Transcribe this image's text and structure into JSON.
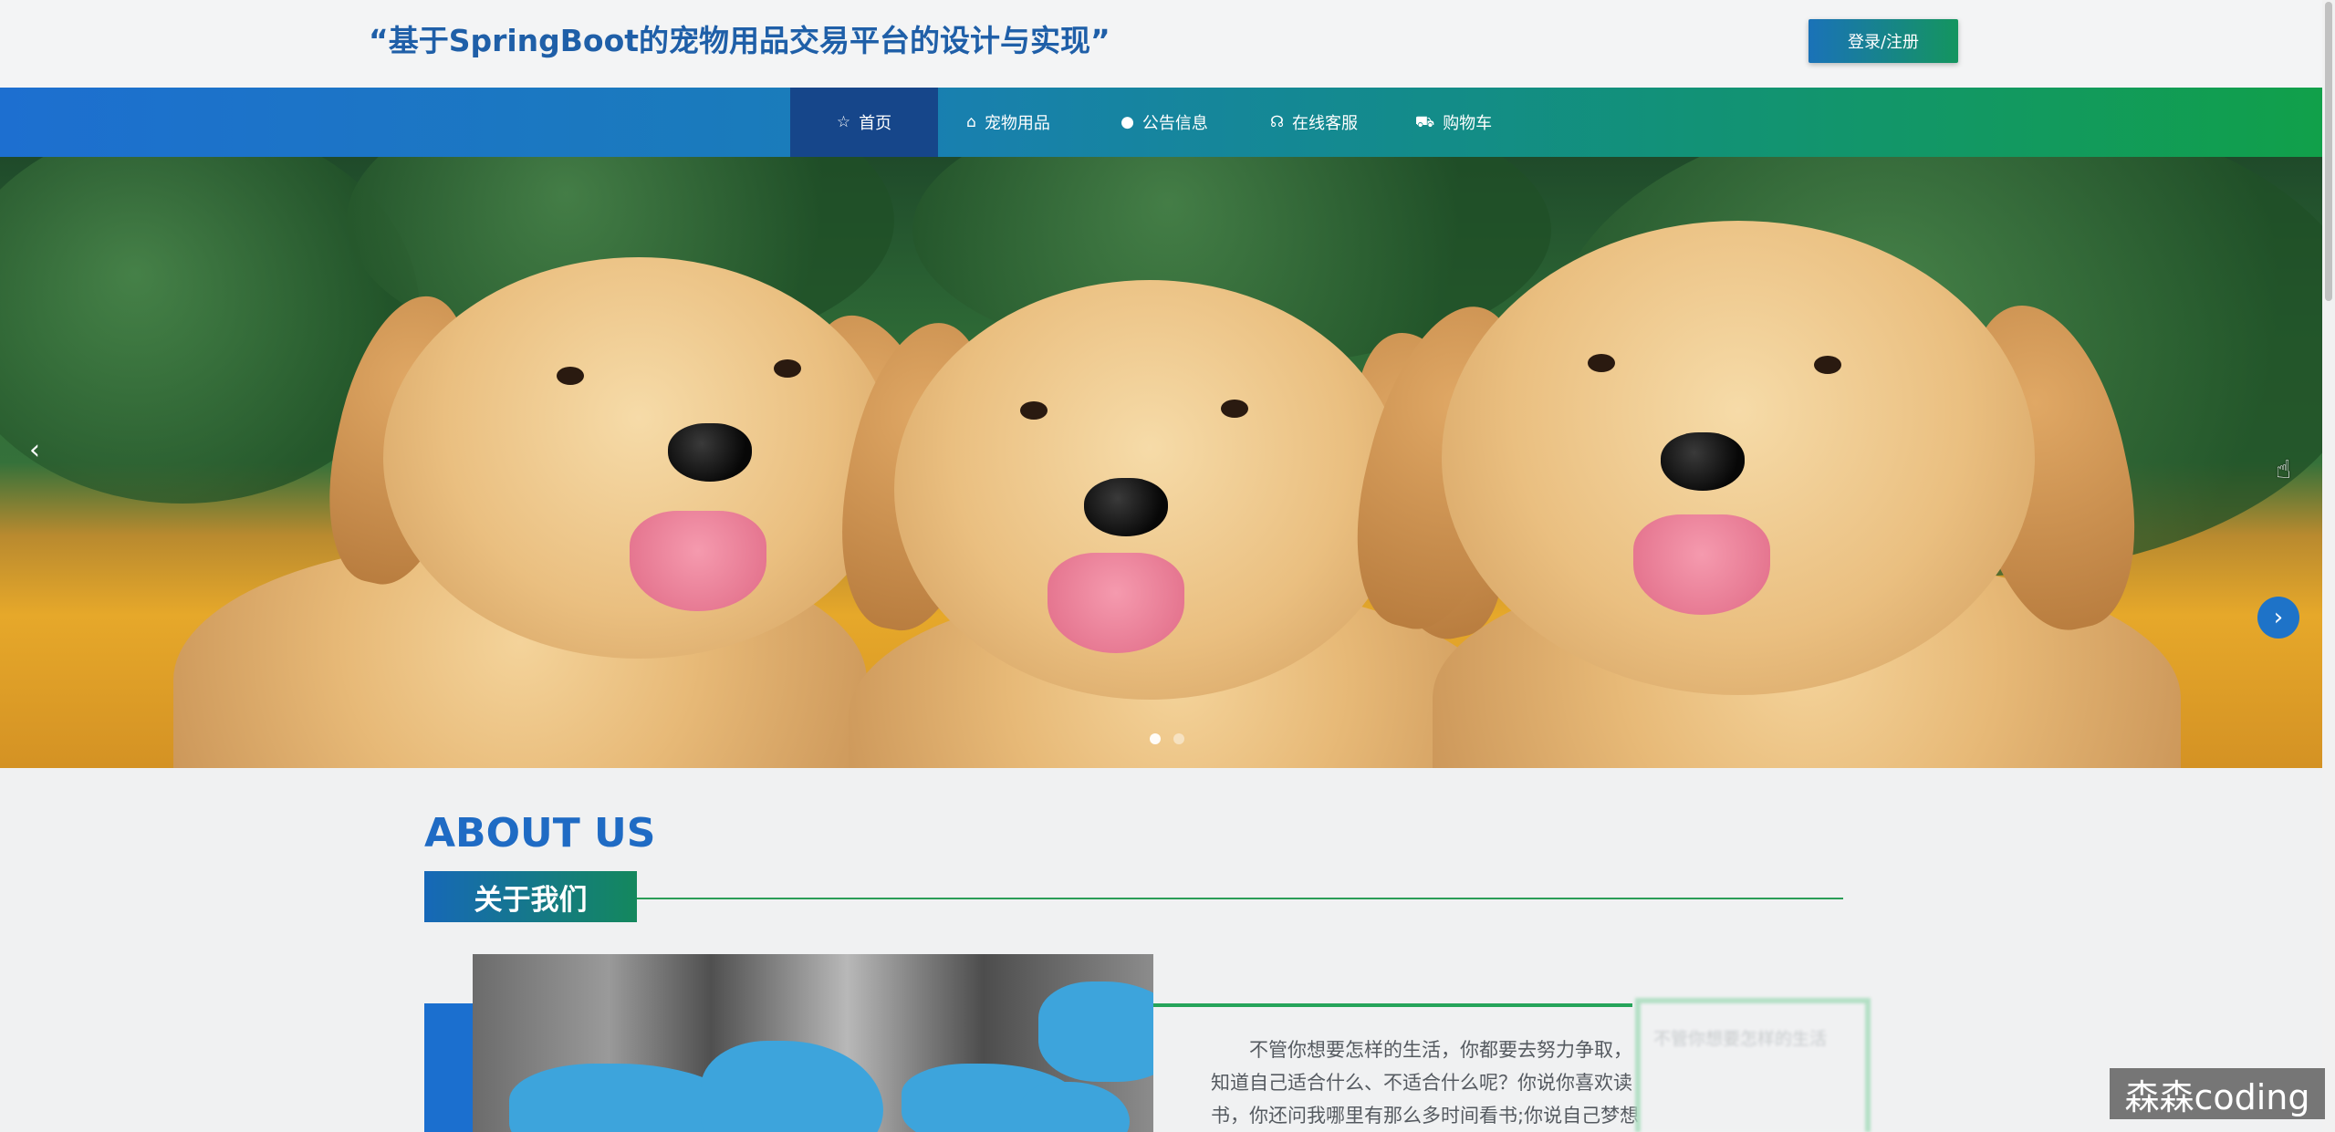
{
  "header": {
    "site_title": "“基于SpringBoot的宠物用品交易平台的设计与实现”",
    "login_label": "登录/注册"
  },
  "nav": {
    "items": [
      {
        "label": "首页",
        "icon": "star-icon",
        "active": true
      },
      {
        "label": "宠物用品",
        "icon": "bag-icon",
        "active": false
      },
      {
        "label": "公告信息",
        "icon": "info-icon",
        "active": false
      },
      {
        "label": "在线客服",
        "icon": "headset-icon",
        "active": false
      },
      {
        "label": "购物车",
        "icon": "cart-icon",
        "active": false
      }
    ]
  },
  "banner": {
    "prev_glyph": "‹",
    "next_glyph": "›"
  },
  "about": {
    "title": "ABOUT US",
    "subtitle": "关于我们",
    "text": "不管你想要怎样的生活，你都要去努力争取，知道自己适合什么、不适合什么呢？你说你喜欢读书，你还问我哪里有那么多时间看书;你说自己梦想的职业",
    "faded_text": "不管你想要怎样的生活"
  },
  "watermark": "森森coding",
  "colors": {
    "primary_blue": "#1f6bc4",
    "primary_green": "#11a04a",
    "nav_active": "#16468a"
  }
}
